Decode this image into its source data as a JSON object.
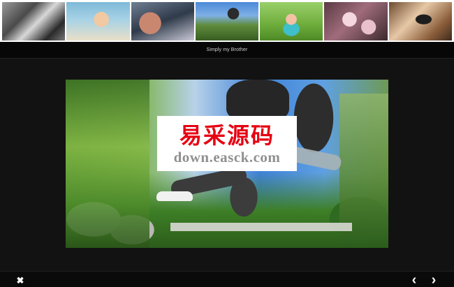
{
  "thumbnails": [
    {
      "id": 1,
      "label": "thumbnail-1"
    },
    {
      "id": 2,
      "label": "thumbnail-2"
    },
    {
      "id": 3,
      "label": "thumbnail-3"
    },
    {
      "id": 4,
      "label": "thumbnail-4"
    },
    {
      "id": 5,
      "label": "thumbnail-5"
    },
    {
      "id": 6,
      "label": "thumbnail-6"
    },
    {
      "id": 7,
      "label": "thumbnail-7"
    }
  ],
  "caption": "Simply my Brother",
  "watermark": {
    "chinese": "易采源码",
    "url": "down.easck.com"
  },
  "controls": {
    "close_icon": "✖",
    "prev_icon": "‹",
    "next_icon": "›"
  },
  "colors": {
    "background": "#121212",
    "strip": "#ffffff",
    "watermark_red": "#e60012"
  }
}
